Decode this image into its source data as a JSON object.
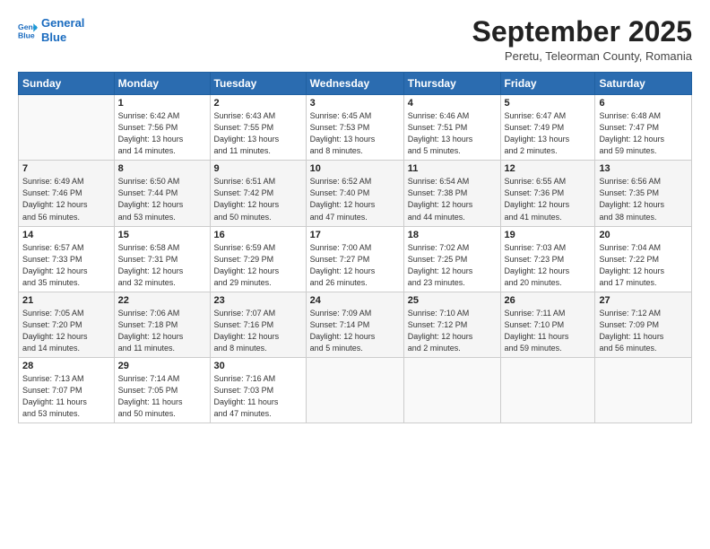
{
  "header": {
    "logo_line1": "General",
    "logo_line2": "Blue",
    "month_title": "September 2025",
    "location": "Peretu, Teleorman County, Romania"
  },
  "days_of_week": [
    "Sunday",
    "Monday",
    "Tuesday",
    "Wednesday",
    "Thursday",
    "Friday",
    "Saturday"
  ],
  "weeks": [
    [
      {
        "num": "",
        "info": ""
      },
      {
        "num": "1",
        "info": "Sunrise: 6:42 AM\nSunset: 7:56 PM\nDaylight: 13 hours\nand 14 minutes."
      },
      {
        "num": "2",
        "info": "Sunrise: 6:43 AM\nSunset: 7:55 PM\nDaylight: 13 hours\nand 11 minutes."
      },
      {
        "num": "3",
        "info": "Sunrise: 6:45 AM\nSunset: 7:53 PM\nDaylight: 13 hours\nand 8 minutes."
      },
      {
        "num": "4",
        "info": "Sunrise: 6:46 AM\nSunset: 7:51 PM\nDaylight: 13 hours\nand 5 minutes."
      },
      {
        "num": "5",
        "info": "Sunrise: 6:47 AM\nSunset: 7:49 PM\nDaylight: 13 hours\nand 2 minutes."
      },
      {
        "num": "6",
        "info": "Sunrise: 6:48 AM\nSunset: 7:47 PM\nDaylight: 12 hours\nand 59 minutes."
      }
    ],
    [
      {
        "num": "7",
        "info": "Sunrise: 6:49 AM\nSunset: 7:46 PM\nDaylight: 12 hours\nand 56 minutes."
      },
      {
        "num": "8",
        "info": "Sunrise: 6:50 AM\nSunset: 7:44 PM\nDaylight: 12 hours\nand 53 minutes."
      },
      {
        "num": "9",
        "info": "Sunrise: 6:51 AM\nSunset: 7:42 PM\nDaylight: 12 hours\nand 50 minutes."
      },
      {
        "num": "10",
        "info": "Sunrise: 6:52 AM\nSunset: 7:40 PM\nDaylight: 12 hours\nand 47 minutes."
      },
      {
        "num": "11",
        "info": "Sunrise: 6:54 AM\nSunset: 7:38 PM\nDaylight: 12 hours\nand 44 minutes."
      },
      {
        "num": "12",
        "info": "Sunrise: 6:55 AM\nSunset: 7:36 PM\nDaylight: 12 hours\nand 41 minutes."
      },
      {
        "num": "13",
        "info": "Sunrise: 6:56 AM\nSunset: 7:35 PM\nDaylight: 12 hours\nand 38 minutes."
      }
    ],
    [
      {
        "num": "14",
        "info": "Sunrise: 6:57 AM\nSunset: 7:33 PM\nDaylight: 12 hours\nand 35 minutes."
      },
      {
        "num": "15",
        "info": "Sunrise: 6:58 AM\nSunset: 7:31 PM\nDaylight: 12 hours\nand 32 minutes."
      },
      {
        "num": "16",
        "info": "Sunrise: 6:59 AM\nSunset: 7:29 PM\nDaylight: 12 hours\nand 29 minutes."
      },
      {
        "num": "17",
        "info": "Sunrise: 7:00 AM\nSunset: 7:27 PM\nDaylight: 12 hours\nand 26 minutes."
      },
      {
        "num": "18",
        "info": "Sunrise: 7:02 AM\nSunset: 7:25 PM\nDaylight: 12 hours\nand 23 minutes."
      },
      {
        "num": "19",
        "info": "Sunrise: 7:03 AM\nSunset: 7:23 PM\nDaylight: 12 hours\nand 20 minutes."
      },
      {
        "num": "20",
        "info": "Sunrise: 7:04 AM\nSunset: 7:22 PM\nDaylight: 12 hours\nand 17 minutes."
      }
    ],
    [
      {
        "num": "21",
        "info": "Sunrise: 7:05 AM\nSunset: 7:20 PM\nDaylight: 12 hours\nand 14 minutes."
      },
      {
        "num": "22",
        "info": "Sunrise: 7:06 AM\nSunset: 7:18 PM\nDaylight: 12 hours\nand 11 minutes."
      },
      {
        "num": "23",
        "info": "Sunrise: 7:07 AM\nSunset: 7:16 PM\nDaylight: 12 hours\nand 8 minutes."
      },
      {
        "num": "24",
        "info": "Sunrise: 7:09 AM\nSunset: 7:14 PM\nDaylight: 12 hours\nand 5 minutes."
      },
      {
        "num": "25",
        "info": "Sunrise: 7:10 AM\nSunset: 7:12 PM\nDaylight: 12 hours\nand 2 minutes."
      },
      {
        "num": "26",
        "info": "Sunrise: 7:11 AM\nSunset: 7:10 PM\nDaylight: 11 hours\nand 59 minutes."
      },
      {
        "num": "27",
        "info": "Sunrise: 7:12 AM\nSunset: 7:09 PM\nDaylight: 11 hours\nand 56 minutes."
      }
    ],
    [
      {
        "num": "28",
        "info": "Sunrise: 7:13 AM\nSunset: 7:07 PM\nDaylight: 11 hours\nand 53 minutes."
      },
      {
        "num": "29",
        "info": "Sunrise: 7:14 AM\nSunset: 7:05 PM\nDaylight: 11 hours\nand 50 minutes."
      },
      {
        "num": "30",
        "info": "Sunrise: 7:16 AM\nSunset: 7:03 PM\nDaylight: 11 hours\nand 47 minutes."
      },
      {
        "num": "",
        "info": ""
      },
      {
        "num": "",
        "info": ""
      },
      {
        "num": "",
        "info": ""
      },
      {
        "num": "",
        "info": ""
      }
    ]
  ]
}
